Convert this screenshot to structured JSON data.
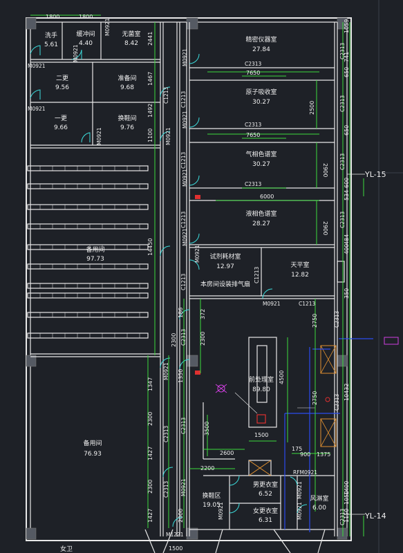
{
  "rooms": [
    {
      "name": "洗手",
      "area": "5.61"
    },
    {
      "name": "缓冲间",
      "area": "4.40"
    },
    {
      "name": "无菌室",
      "area": "8.42"
    },
    {
      "name": "二更",
      "area": "9.56"
    },
    {
      "name": "准备间",
      "area": "9.68"
    },
    {
      "name": "一更",
      "area": "9.66"
    },
    {
      "name": "换鞋间",
      "area": "9.76"
    },
    {
      "name": "备用间",
      "area": "97.73"
    },
    {
      "name": "备用间",
      "area": "76.93"
    },
    {
      "name": "精密仪器室",
      "area": "27.84"
    },
    {
      "name": "原子吸收室",
      "area": "30.27"
    },
    {
      "name": "气相色谱室",
      "area": "30.27"
    },
    {
      "name": "液相色谱室",
      "area": "28.27"
    },
    {
      "name": "试剂耗材室",
      "area": "12.97"
    },
    {
      "name": "天平室",
      "area": "12.82"
    },
    {
      "name": "前处理室",
      "area": "89.80"
    },
    {
      "name": "男更衣室",
      "area": "6.52"
    },
    {
      "name": "女更衣室",
      "area": "6.31"
    },
    {
      "name": "换鞋区",
      "area": "19.05"
    },
    {
      "name": "风淋室",
      "area": "6.00"
    }
  ],
  "notes": {
    "fume_hood": "本房间设装排气扇"
  },
  "axes": {
    "axis_a": "YL-15",
    "axis_b": "YL-14"
  },
  "partial": {
    "bottom_left": "女卫"
  },
  "door_tags": {
    "m0921": "M0921",
    "m1221": "M1221",
    "rfm0921": "RFM0921",
    "c1213": "C1213",
    "c2313": "C2313"
  },
  "dims": {
    "d1800": "1800",
    "d2441": "2441",
    "d1467": "1467",
    "d1492": "1492",
    "d14450": "14450",
    "d1347": "1347",
    "d2300": "2300",
    "d1427": "1427",
    "d1350": "1350",
    "d4500": "4500",
    "d3500": "3500",
    "d2600": "2600",
    "d2200": "2200",
    "d7650": "7650",
    "d6000": "6000",
    "d2500": "2500",
    "d1500": "1500",
    "d175": "175",
    "d900": "900",
    "d1375": "1375",
    "d2750": "2750",
    "d10432": "10432",
    "d1400": "1400",
    "d1050": "1050",
    "d1150": "1150",
    "d741": "741",
    "d650": "650",
    "d600": "600",
    "d534": "534",
    "d484": "484",
    "d400": "400",
    "d350": "350",
    "d372": "372",
    "d186": "186",
    "d2000": "2000",
    "d1059": "1059",
    "d1100": "1100",
    "d650b": "650",
    "d2900": "2900"
  }
}
